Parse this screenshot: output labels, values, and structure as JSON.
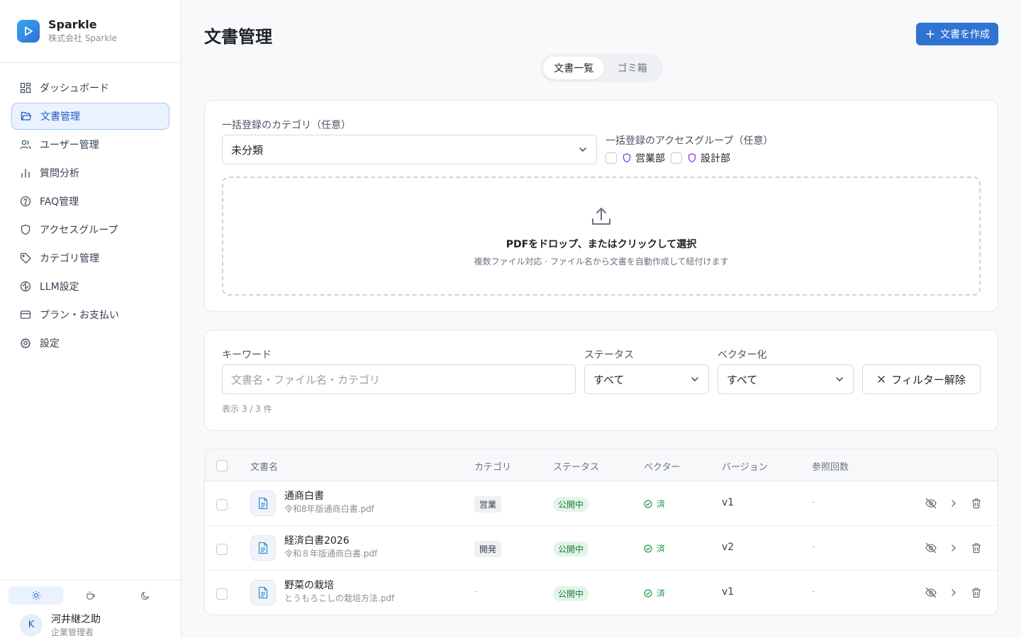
{
  "brand": {
    "name": "Sparkle",
    "company": "株式会社 Sparkle"
  },
  "nav": [
    {
      "label": "ダッシュボード",
      "icon": "dashboard-icon",
      "active": false
    },
    {
      "label": "文書管理",
      "icon": "folder-icon",
      "active": true
    },
    {
      "label": "ユーザー管理",
      "icon": "users-icon",
      "active": false
    },
    {
      "label": "質問分析",
      "icon": "bar-chart-icon",
      "active": false
    },
    {
      "label": "FAQ管理",
      "icon": "help-circle-icon",
      "active": false
    },
    {
      "label": "アクセスグループ",
      "icon": "shield-icon",
      "active": false
    },
    {
      "label": "カテゴリ管理",
      "icon": "tag-icon",
      "active": false
    },
    {
      "label": "LLM設定",
      "icon": "brain-icon",
      "active": false
    },
    {
      "label": "プラン・お支払い",
      "icon": "credit-card-icon",
      "active": false
    },
    {
      "label": "設定",
      "icon": "gear-icon",
      "active": false
    }
  ],
  "user": {
    "initial": "K",
    "name": "河井継之助",
    "role": "企業管理者"
  },
  "page": {
    "title": "文書管理",
    "create_label": "文書を作成"
  },
  "tabs": {
    "list": "文書一覧",
    "trash": "ゴミ箱"
  },
  "upload": {
    "category_label": "一括登録のカテゴリ（任意）",
    "category_value": "未分類",
    "group_label": "一括登録のアクセスグループ（任意）",
    "groups": [
      "営業部",
      "設計部"
    ],
    "drop_title": "PDFをドロップ、またはクリックして選択",
    "drop_sub": "複数ファイル対応 · ファイル名から文書を自動作成して紐付けます"
  },
  "filters": {
    "keyword_label": "キーワード",
    "keyword_placeholder": "文書名・ファイル名・カテゴリ",
    "status_label": "ステータス",
    "status_value": "すべて",
    "vector_label": "ベクター化",
    "vector_value": "すべて",
    "clear_label": "フィルター解除",
    "count_text": "表示 3 / 3 件"
  },
  "table": {
    "headers": {
      "name": "文書名",
      "category": "カテゴリ",
      "status": "ステータス",
      "vector": "ベクター",
      "version": "バージョン",
      "refs": "参照回数"
    },
    "rows": [
      {
        "name": "通商白書",
        "file": "令和8年版通商白書.pdf",
        "category": "営業",
        "status": "公開中",
        "vector": "済",
        "version": "v1",
        "refs": "-"
      },
      {
        "name": "経済白書2026",
        "file": "令和８年版通商白書.pdf",
        "category": "開発",
        "status": "公開中",
        "vector": "済",
        "version": "v2",
        "refs": "-"
      },
      {
        "name": "野菜の栽培",
        "file": "とうもろこしの栽培方法.pdf",
        "category": "-",
        "status": "公開中",
        "vector": "済",
        "version": "v1",
        "refs": "-"
      }
    ]
  },
  "colors": {
    "accent": "#2f73d3",
    "sidebar_active_bg": "#ebf2ff",
    "success": "#1f9a4a"
  }
}
